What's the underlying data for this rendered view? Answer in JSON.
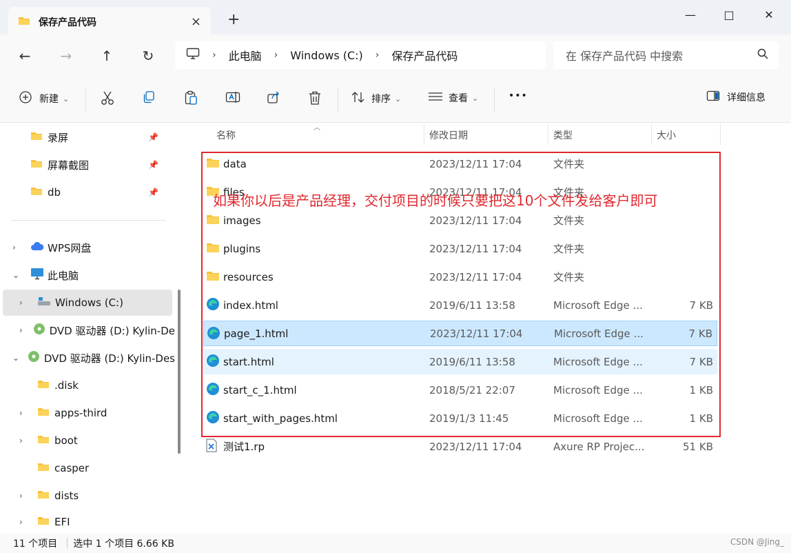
{
  "tab": {
    "title": "保存产品代码",
    "close": "×",
    "new_tab": "+"
  },
  "window_controls": {
    "minimize": "—",
    "maximize": "□",
    "close": "✕"
  },
  "nav": {
    "back": "←",
    "forward": "→",
    "up": "↑",
    "refresh": "↻"
  },
  "address": {
    "parts": [
      "此电脑",
      "Windows (C:)",
      "保存产品代码"
    ],
    "sep": "›"
  },
  "search": {
    "placeholder": "在 保存产品代码 中搜索"
  },
  "toolbar": {
    "new_label": "新建",
    "sort_label": "排序",
    "view_label": "查看",
    "more": "•••",
    "details_label": "详细信息",
    "caret": "⌄"
  },
  "sidebar": {
    "quick": [
      {
        "label": "录屏"
      },
      {
        "label": "屏幕截图"
      },
      {
        "label": "db"
      }
    ],
    "tree": [
      {
        "label": "WPS网盘"
      },
      {
        "label": "此电脑"
      },
      {
        "label": "Windows (C:)"
      },
      {
        "label": "DVD 驱动器 (D:) Kylin-De"
      },
      {
        "label": "DVD 驱动器 (D:) Kylin-Des"
      },
      {
        "label": ".disk"
      },
      {
        "label": "apps-third"
      },
      {
        "label": "boot"
      },
      {
        "label": "casper"
      },
      {
        "label": "dists"
      },
      {
        "label": "EFI"
      }
    ]
  },
  "columns": {
    "name": "名称",
    "date": "修改日期",
    "type": "类型",
    "size": "大小"
  },
  "files": [
    {
      "name": "data",
      "date": "2023/12/11 17:04",
      "type": "文件夹",
      "size": "",
      "kind": "folder"
    },
    {
      "name": "files",
      "date": "2023/12/11 17:04",
      "type": "文件夹",
      "size": "",
      "kind": "folder"
    },
    {
      "name": "images",
      "date": "2023/12/11 17:04",
      "type": "文件夹",
      "size": "",
      "kind": "folder"
    },
    {
      "name": "plugins",
      "date": "2023/12/11 17:04",
      "type": "文件夹",
      "size": "",
      "kind": "folder"
    },
    {
      "name": "resources",
      "date": "2023/12/11 17:04",
      "type": "文件夹",
      "size": "",
      "kind": "folder"
    },
    {
      "name": "index.html",
      "date": "2019/6/11 13:58",
      "type": "Microsoft Edge ...",
      "size": "7 KB",
      "kind": "edge"
    },
    {
      "name": "page_1.html",
      "date": "2023/12/11 17:04",
      "type": "Microsoft Edge ...",
      "size": "7 KB",
      "kind": "edge"
    },
    {
      "name": "start.html",
      "date": "2019/6/11 13:58",
      "type": "Microsoft Edge ...",
      "size": "7 KB",
      "kind": "edge"
    },
    {
      "name": "start_c_1.html",
      "date": "2018/5/21 22:07",
      "type": "Microsoft Edge ...",
      "size": "1 KB",
      "kind": "edge"
    },
    {
      "name": "start_with_pages.html",
      "date": "2019/1/3 11:45",
      "type": "Microsoft Edge ...",
      "size": "1 KB",
      "kind": "edge"
    },
    {
      "name": "测试1.rp",
      "date": "2023/12/11 17:04",
      "type": "Axure RP Projec...",
      "size": "51 KB",
      "kind": "rp"
    }
  ],
  "annotation": {
    "text": "如果你以后是产品经理，交付项目的时候只要把这10个文件发给客户即可"
  },
  "status": {
    "count": "11 个项目",
    "selected": "选中 1 个项目 6.66 KB"
  },
  "watermark": "CSDN @Jing_",
  "colors": {
    "accent": "#0067c0",
    "selected_row": "#cce8ff",
    "hover_row": "#e5f3ff",
    "annotation": "#e0282e",
    "folder": "#f8c13a"
  }
}
